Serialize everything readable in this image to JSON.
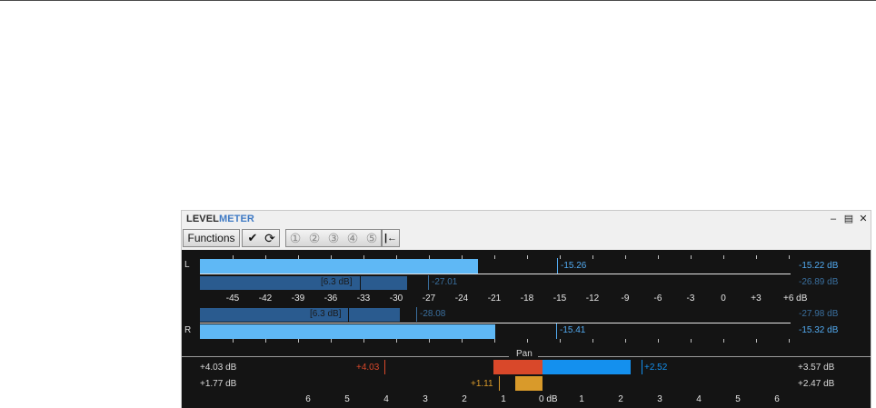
{
  "window": {
    "title_part1": "LEVEL",
    "title_part2": "METER",
    "minimize_label": "–",
    "menu_label": "▤",
    "close_label": "✕"
  },
  "toolbar": {
    "functions_label": "Functions",
    "checkmark_label": "✔",
    "refresh_label": "⟳",
    "presets": [
      "①",
      "②",
      "③",
      "④",
      "⑤"
    ],
    "reset_label": "|←"
  },
  "level": {
    "left_label": "L",
    "right_label": "R",
    "scale": [
      "-45",
      "-42",
      "-39",
      "-36",
      "-33",
      "-30",
      "-27",
      "-24",
      "-21",
      "-18",
      "-15",
      "-12",
      "-9",
      "-6",
      "-3",
      "0",
      "+3",
      "+6 dB"
    ],
    "left_peak": {
      "level_db": -22.5,
      "hold_label": "-15.26",
      "readout": "-15.22 dB"
    },
    "left_rms": {
      "level_db": -29.0,
      "inner_label": "[6.3 dB]",
      "hold_label": "-27.01",
      "readout": "-26.89 dB"
    },
    "right_rms": {
      "level_db": -29.7,
      "inner_label": "[6.3 dB]",
      "hold_label": "-28.08",
      "readout": "-27.98 dB"
    },
    "right_peak": {
      "level_db": -20.9,
      "hold_label": "-15.41",
      "readout": "-15.32 dB"
    }
  },
  "pan": {
    "title": "Pan",
    "row1_left_value": "+4.03 dB",
    "row1_left_marker": "+4.03",
    "row1_right_marker": "+2.52",
    "row1_right_value": "+3.57 dB",
    "row1_left_db": 1.25,
    "row1_right_db": 2.25,
    "row2_left_value": "+1.77 dB",
    "row2_left_marker": "+1.11",
    "row2_right_value": "+2.47 dB",
    "row2_left_db": 0.7,
    "scale": [
      "6",
      "5",
      "4",
      "3",
      "2",
      "1",
      "0 dB",
      "1",
      "2",
      "3",
      "4",
      "5",
      "6"
    ]
  },
  "colors": {
    "peak_bar": "#5fb8f5",
    "rms_bar": "#2a5b8f",
    "readout_blue": "#52aaf0",
    "readout_dim": "#3a6f9e",
    "pan_red": "#d9482a",
    "pan_blue": "#1490ee",
    "pan_orange": "#d99a2a"
  }
}
